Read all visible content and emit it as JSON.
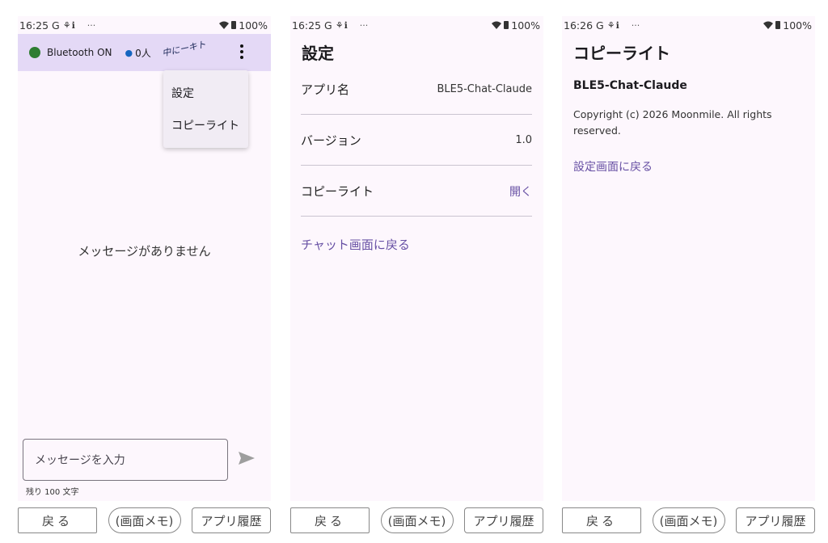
{
  "screen1": {
    "status": {
      "time": "16:25",
      "carrier": "G",
      "icons": "⚘ℹ",
      "dots": "···",
      "battery": "100%"
    },
    "topbar": {
      "bt_label": "Bluetooth ON",
      "people_count": "0人",
      "overlay_text": "中にーキト"
    },
    "menu": [
      "設定",
      "コピーライト"
    ],
    "empty_message": "メッセージがありません",
    "input_placeholder": "メッセージを入力",
    "remaining": "残り 100 文字"
  },
  "screen2": {
    "status": {
      "time": "16:25",
      "carrier": "G",
      "icons": "⚘ℹ",
      "dots": "···",
      "battery": "100%"
    },
    "title": "設定",
    "rows": [
      {
        "label": "アプリ名",
        "value": "BLE5-Chat-Claude"
      },
      {
        "label": "バージョン",
        "value": "1.0"
      },
      {
        "label": "コピーライト",
        "value": "開く"
      }
    ],
    "back_link": "チャット画面に戻る"
  },
  "screen3": {
    "status": {
      "time": "16:26",
      "carrier": "G",
      "icons": "⚘ℹ",
      "dots": "···",
      "battery": "100%"
    },
    "title": "コピーライト",
    "app_name": "BLE5-Chat-Claude",
    "copyright": "Copyright (c) 2026 Moonmile. All rights reserved.",
    "back_link": "設定画面に戻る"
  },
  "system_buttons": {
    "back": "戻る",
    "memo": "(画面メモ)",
    "history": "アプリ履歴"
  },
  "colors": {
    "accent": "#6750a4",
    "topbar_bg": "#e4d9f6",
    "bt_on": "#2e7d32",
    "screen_bg": "#fdf7fd"
  }
}
